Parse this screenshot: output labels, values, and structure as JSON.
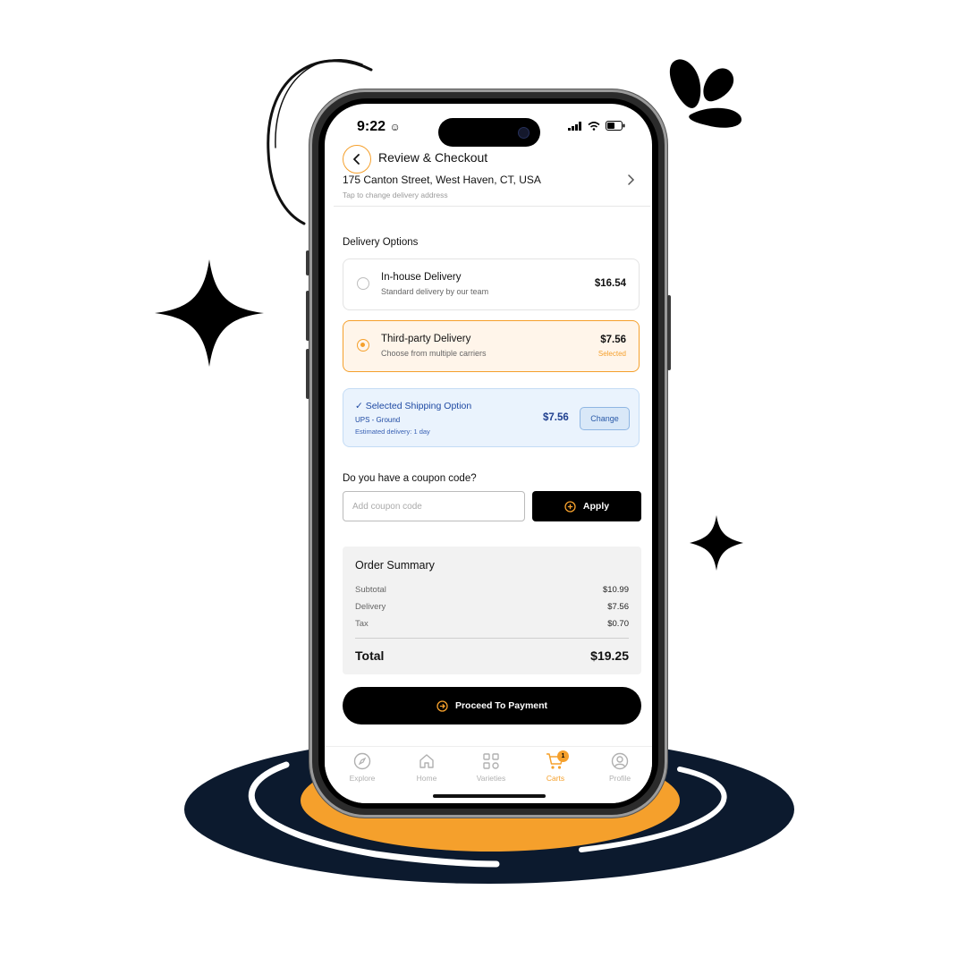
{
  "colors": {
    "accent": "#f5a02c",
    "dark": "#000000",
    "navy": "#0c1a2e",
    "ship_blue": "#1f4aa3"
  },
  "status_bar": {
    "time": "9:22",
    "icons": [
      "face-icon",
      "signal-icon",
      "wifi-icon",
      "battery-icon"
    ]
  },
  "header": {
    "title": "Review & Checkout",
    "back_icon": "chevron-left-icon"
  },
  "address": {
    "line": "175 Canton Street, West Haven, CT, USA",
    "hint": "Tap to change delivery address"
  },
  "delivery": {
    "section_label": "Delivery Options",
    "options": [
      {
        "title": "In-house Delivery",
        "subtitle": "Standard delivery by our team",
        "price": "$16.54",
        "selected": false
      },
      {
        "title": "Third-party Delivery",
        "subtitle": "Choose from multiple carriers",
        "price": "$7.56",
        "selected": true,
        "selected_label": "Selected"
      }
    ]
  },
  "shipping": {
    "title": "✓ Selected Shipping Option",
    "carrier": "UPS - Ground",
    "eta": "Estimated delivery: 1 day",
    "price": "$7.56",
    "change_label": "Change"
  },
  "coupon": {
    "label": "Do you have a coupon code?",
    "placeholder": "Add coupon code",
    "apply_label": "Apply"
  },
  "summary": {
    "title": "Order Summary",
    "rows": [
      {
        "label": "Subtotal",
        "value": "$10.99"
      },
      {
        "label": "Delivery",
        "value": "$7.56"
      },
      {
        "label": "Tax",
        "value": "$0.70"
      }
    ],
    "total_label": "Total",
    "total_value": "$19.25"
  },
  "cta": {
    "label": "Proceed To Payment"
  },
  "tabbar": {
    "tabs": [
      {
        "label": "Explore",
        "icon": "compass-icon"
      },
      {
        "label": "Home",
        "icon": "home-icon"
      },
      {
        "label": "Varieties",
        "icon": "grid-icon"
      },
      {
        "label": "Carts",
        "icon": "cart-icon",
        "active": true,
        "badge": "1"
      },
      {
        "label": "Profile",
        "icon": "user-icon"
      }
    ]
  }
}
